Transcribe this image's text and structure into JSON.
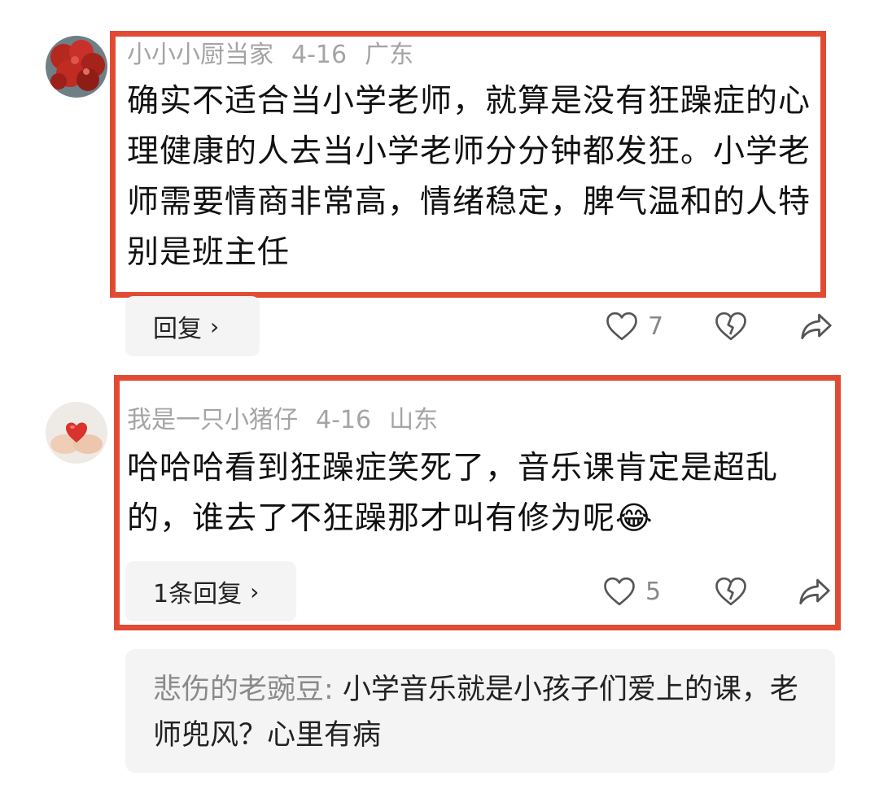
{
  "comments": [
    {
      "author": "小小小厨当家",
      "date": "4-16",
      "location": "广东",
      "text": "确实不适合当小学老师，就算是没有狂躁症的心理健康的人去当小学老师分分钟都发狂。小学老师需要情商非常高，情绪稳定，脾气温和的人特别是班主任",
      "reply_label": "回复",
      "likes": "7",
      "avatar_icon": "red-tree-avatar"
    },
    {
      "author": "我是一只小猪仔",
      "date": "4-16",
      "location": "山东",
      "text": "哈哈哈看到狂躁症笑死了，音乐课肯定是超乱的，谁去了不狂躁那才叫有修为呢",
      "emoji": "😂",
      "reply_label": "1条回复",
      "likes": "5",
      "avatar_icon": "heart-hands-avatar"
    }
  ],
  "sub_reply": {
    "author": "悲伤的老豌豆:",
    "text": " 小学音乐就是小孩子们爱上的课，老师兜风？心里有病"
  },
  "icons": {
    "like": "heart-outline-icon",
    "dislike": "broken-heart-icon",
    "share": "share-arrow-icon"
  },
  "colors": {
    "highlight": "#e24b33",
    "meta": "#a4a4a4",
    "button_bg": "#f4f4f4"
  }
}
